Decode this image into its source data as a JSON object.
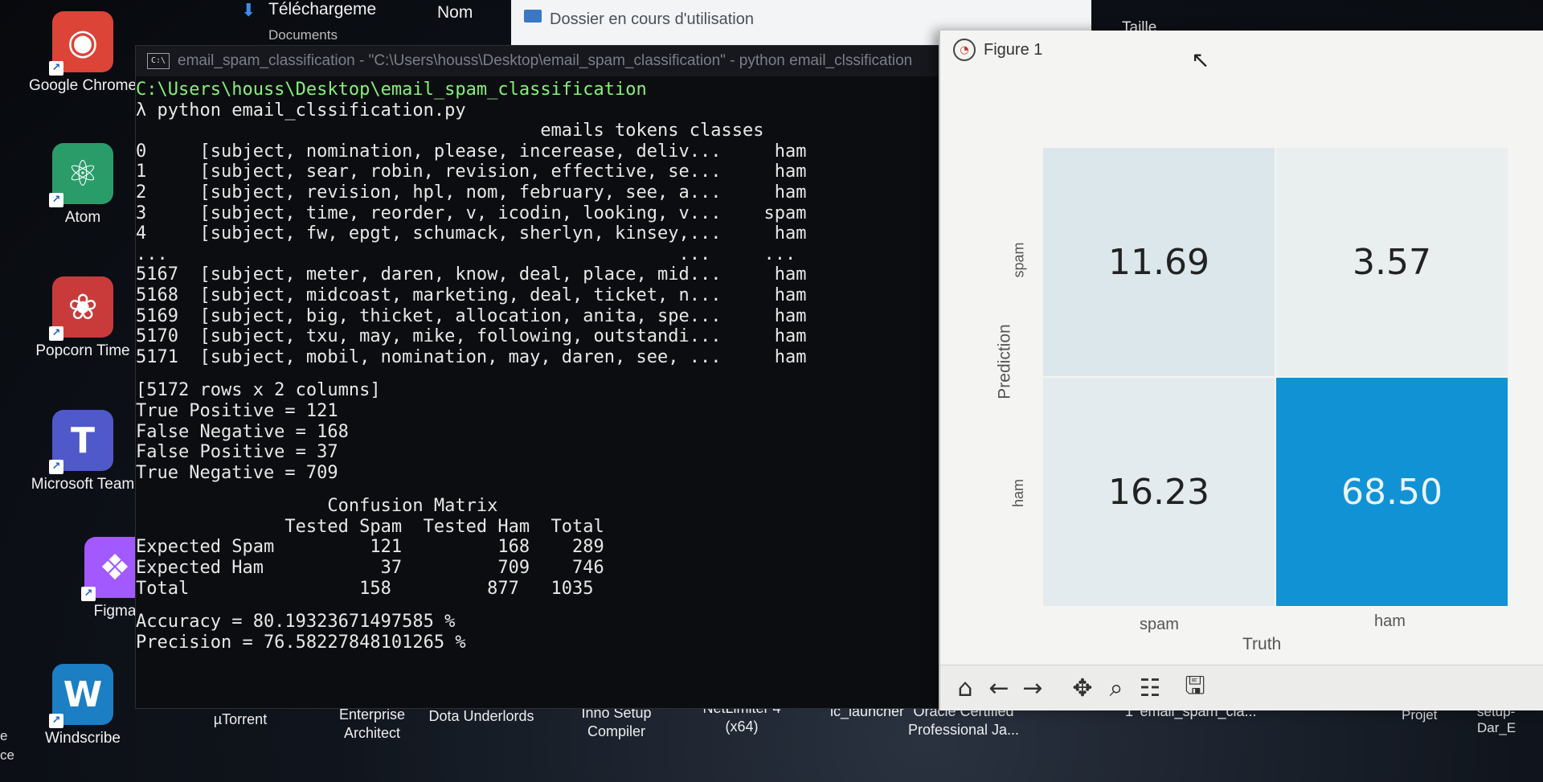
{
  "desktop_icons": [
    {
      "label": "Google Chrome",
      "color": "#db4437"
    },
    {
      "label": "Atom",
      "color": "#2a9c6a"
    },
    {
      "label": "Popcorn Time",
      "color": "#c93b3b"
    },
    {
      "label": "Microsoft Team",
      "color": "#5059c9"
    },
    {
      "label": "Figma",
      "color": "#a259ff"
    },
    {
      "label": "Windscribe",
      "color": "#1c7fc4"
    }
  ],
  "bottom_icons": [
    {
      "label": "µTorrent"
    },
    {
      "label": "Enterprise\nArchitect"
    },
    {
      "label": "Dota Underlords"
    },
    {
      "label": "Inno Setup\nCompiler"
    },
    {
      "label": "NetLimiter 4\n(x64)"
    },
    {
      "label": "ic_launcher"
    },
    {
      "label": "Oracle Certified\nProfessional Ja..."
    },
    {
      "label": "1"
    },
    {
      "label": "email_spam_cla..."
    }
  ],
  "left_edge_labels": [
    "e",
    "ce"
  ],
  "right_labels": {
    "projet": "Projet",
    "setup": "setup-Dar_E"
  },
  "explorer": {
    "downloads": "Téléchargeme",
    "documents": "Documents",
    "nom": "Nom",
    "dialog": "Dossier en cours d'utilisation",
    "taille": "Taille"
  },
  "console": {
    "title": "email_spam_classification - \"C:\\Users\\houss\\Desktop\\email_spam_classification\" - python  email_clssification",
    "path_line": "C:\\Users\\houss\\Desktop\\email_spam_classification",
    "command_line": "λ python email_clssification.py",
    "header_line": "                                      emails tokens classes",
    "df_lines": [
      "0     [subject, nomination, please, incerease, deliv...     ham",
      "1     [subject, sear, robin, revision, effective, se...     ham",
      "2     [subject, revision, hpl, nom, february, see, a...     ham",
      "3     [subject, time, reorder, v, icodin, looking, v...    spam",
      "4     [subject, fw, epgt, schumack, sherlyn, kinsey,...     ham",
      "...                                                ...     ...",
      "5167  [subject, meter, daren, know, deal, place, mid...     ham",
      "5168  [subject, midcoast, marketing, deal, ticket, n...     ham",
      "5169  [subject, big, thicket, allocation, anita, spe...     ham",
      "5170  [subject, txu, may, mike, following, outstandi...     ham",
      "5171  [subject, mobil, nomination, may, daren, see, ...     ham"
    ],
    "summary_lines": [
      "[5172 rows x 2 columns]",
      "True Positive = 121",
      "False Negative = 168",
      "False Positive = 37",
      "True Negative = 709"
    ],
    "matrix_lines": [
      "                  Confusion Matrix",
      "              Tested Spam  Tested Ham  Total",
      "Expected Spam         121         168    289",
      "Expected Ham           37         709    746",
      "Total                158         877   1035"
    ],
    "metric_lines": [
      "Accuracy = 80.19323671497585 %",
      "Precision = 76.58227848101265 %"
    ]
  },
  "figure": {
    "title": "Figure 1",
    "toolbar": [
      "home-icon",
      "back-icon",
      "forward-icon",
      "pan-icon",
      "zoom-icon",
      "configure-icon",
      "save-icon"
    ],
    "chart_data": {
      "type": "heatmap",
      "xlabel": "Truth",
      "ylabel": "Prediction",
      "x_categories": [
        "spam",
        "ham"
      ],
      "y_categories": [
        "spam",
        "ham"
      ],
      "values": [
        [
          11.69,
          3.57
        ],
        [
          16.23,
          68.5
        ]
      ],
      "value_labels": [
        [
          "11.69",
          "3.57"
        ],
        [
          "16.23",
          "68.50"
        ]
      ],
      "colors": [
        [
          "#dbe7ea",
          "#e9eeef"
        ],
        [
          "#e3ebee",
          "#1192d4"
        ]
      ]
    }
  }
}
